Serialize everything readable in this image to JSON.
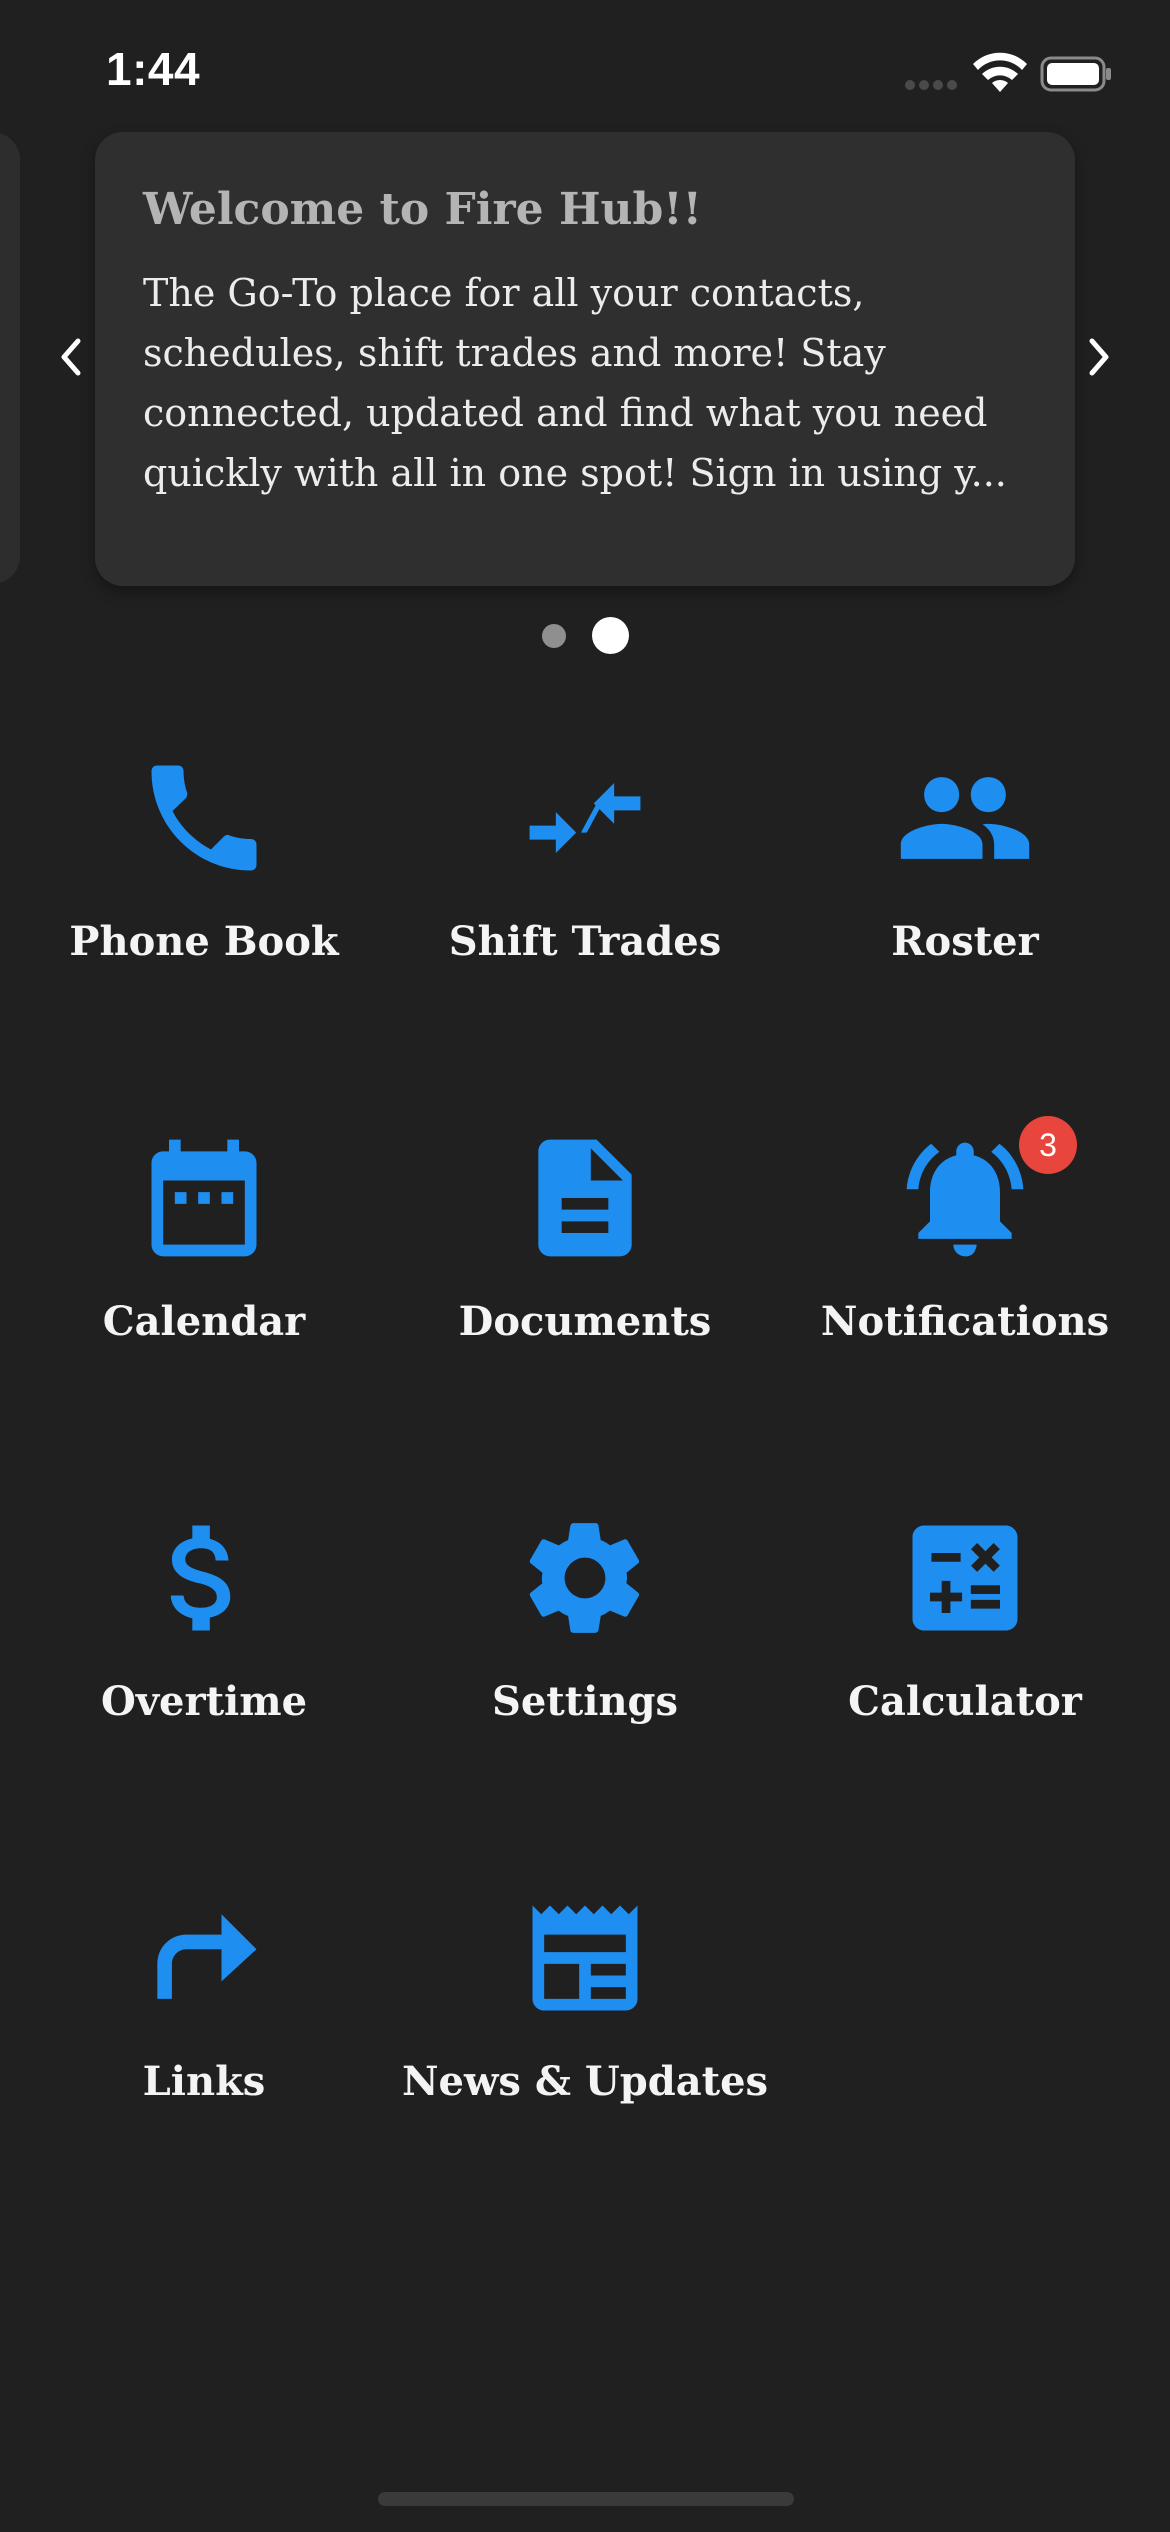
{
  "status_bar": {
    "time": "1:44"
  },
  "carousel": {
    "title": "Welcome to Fire Hub!!",
    "body": "The Go-To place for all your contacts, schedules, shift trades and more! Stay connected, updated and find what you need quickly with all in one spot! Sign in using y...",
    "page_count": 2,
    "active_page": 2
  },
  "colors": {
    "background": "#202020",
    "card": "#2f2f2f",
    "accent": "#1e8ff0",
    "badge": "#e8453c"
  },
  "menu": {
    "phone_book": {
      "label": "Phone Book",
      "icon": "phone-icon"
    },
    "shift_trades": {
      "label": "Shift Trades",
      "icon": "swap-arrows-icon"
    },
    "roster": {
      "label": "Roster",
      "icon": "people-icon"
    },
    "calendar": {
      "label": "Calendar",
      "icon": "calendar-icon"
    },
    "documents": {
      "label": "Documents",
      "icon": "document-icon"
    },
    "notifications": {
      "label": "Notifications",
      "icon": "bell-ringing-icon",
      "badge": "3"
    },
    "overtime": {
      "label": "Overtime",
      "icon": "dollar-icon"
    },
    "settings": {
      "label": "Settings",
      "icon": "gear-icon"
    },
    "calculator": {
      "label": "Calculator",
      "icon": "calculator-icon"
    },
    "links": {
      "label": "Links",
      "icon": "share-arrow-icon"
    },
    "news": {
      "label": "News & Updates",
      "icon": "newspaper-icon"
    }
  }
}
